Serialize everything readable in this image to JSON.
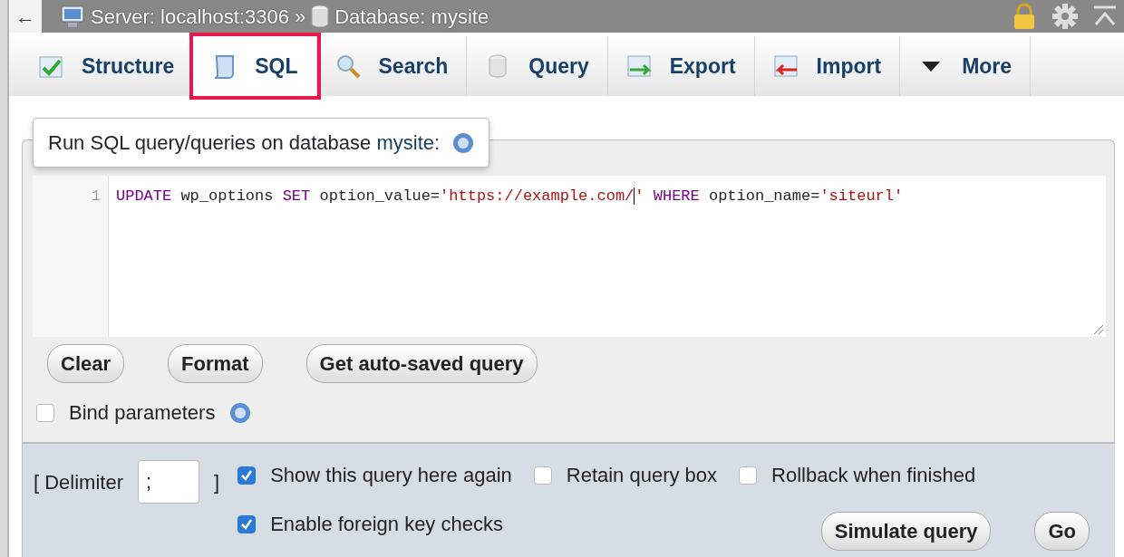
{
  "back": "←",
  "breadcrumb": {
    "server": "Server: localhost:3306",
    "separator": "»",
    "database": "Database: mysite"
  },
  "tabs": [
    {
      "label": "Structure",
      "selected": false,
      "highlighted": false
    },
    {
      "label": "SQL",
      "selected": true,
      "highlighted": true
    },
    {
      "label": "Search",
      "selected": false,
      "highlighted": false
    },
    {
      "label": "Query",
      "selected": false,
      "highlighted": false
    },
    {
      "label": "Export",
      "selected": false,
      "highlighted": false
    },
    {
      "label": "Import",
      "selected": false,
      "highlighted": false
    },
    {
      "label": "More",
      "selected": false,
      "highlighted": false
    }
  ],
  "panel": {
    "legend": "Run SQL query/queries on database",
    "legend_link": "mysite:",
    "editor": {
      "line_number": "1",
      "tokens": [
        {
          "kind": "keyword",
          "text": "UPDATE"
        },
        {
          "kind": "plain",
          "text": " wp_options "
        },
        {
          "kind": "keyword",
          "text": "SET"
        },
        {
          "kind": "plain",
          "text": " option_value="
        },
        {
          "kind": "string",
          "text": "'https://example.com/"
        },
        {
          "kind": "cursor"
        },
        {
          "kind": "string",
          "text": "'"
        },
        {
          "kind": "keyword",
          "text": " WHERE"
        },
        {
          "kind": "plain",
          "text": " option_name="
        },
        {
          "kind": "string",
          "text": "'siteurl'"
        }
      ]
    },
    "buttons": [
      "Clear",
      "Format",
      "Get auto-saved query"
    ],
    "bind_parameters": {
      "label": "Bind parameters",
      "checked": false
    }
  },
  "options": {
    "delimiter_open": "[ Delimiter",
    "delimiter_value": ";",
    "delimiter_close": "]",
    "checkboxes": [
      {
        "label": "Show this query here again",
        "checked": true
      },
      {
        "label": "Retain query box",
        "checked": false
      },
      {
        "label": "Rollback when finished",
        "checked": false
      },
      {
        "label": "Enable foreign key checks",
        "checked": true
      }
    ],
    "buttons": [
      "Simulate query",
      "Go"
    ]
  }
}
